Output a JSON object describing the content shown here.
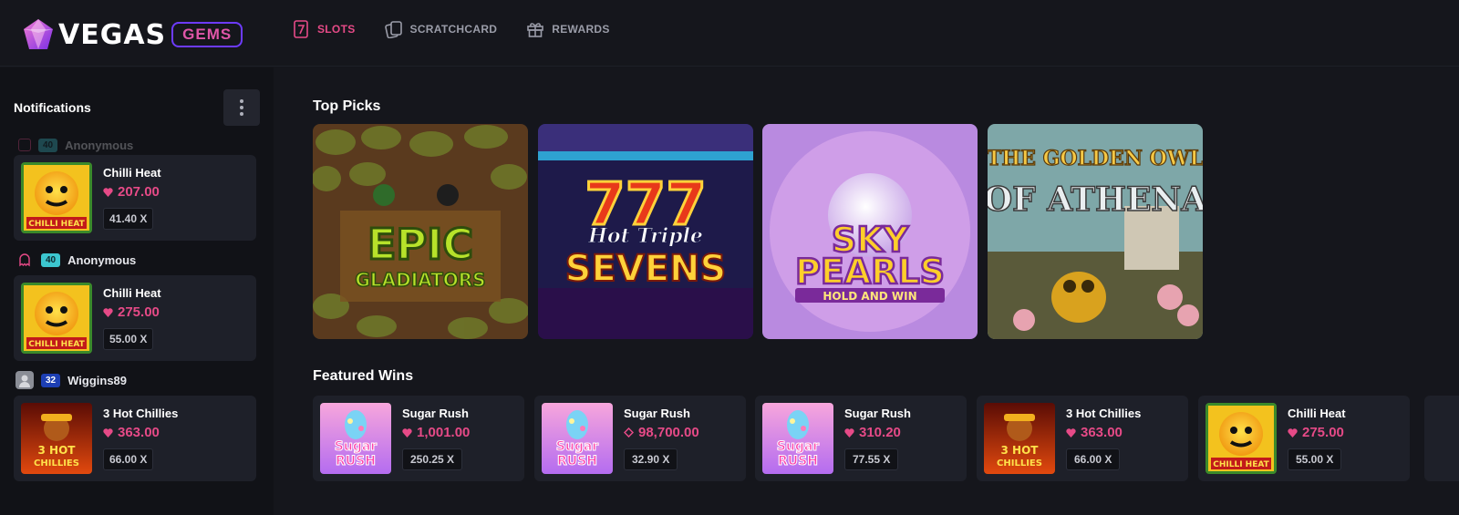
{
  "header": {
    "logo_word": "VEGAS",
    "logo_badge": "GEMS",
    "nav": [
      {
        "label": "SLOTS",
        "icon": "slot-seven-icon",
        "active": true
      },
      {
        "label": "SCRATCHCARD",
        "icon": "scratchcard-icon",
        "active": false
      },
      {
        "label": "REWARDS",
        "icon": "gift-icon",
        "active": false
      }
    ]
  },
  "sidebar": {
    "title": "Notifications",
    "ghost": {
      "level": "40",
      "user": "Anonymous"
    },
    "items": [
      {
        "user": null,
        "level": null,
        "game": "Chilli Heat",
        "amount": "207.00",
        "multiplier": "41.40 X"
      },
      {
        "user": "Anonymous",
        "level": "40",
        "game": "Chilli Heat",
        "amount": "275.00",
        "multiplier": "55.00 X"
      },
      {
        "user": "Wiggins89",
        "level": "32",
        "game": "3 Hot Chillies",
        "amount": "363.00",
        "multiplier": "66.00 X"
      }
    ]
  },
  "main": {
    "top_picks_title": "Top Picks",
    "featured_title": "Featured Wins",
    "top_picks": [
      {
        "line1": "EPIC",
        "line2": "GLADIATORS"
      },
      {
        "line1": "Hot Triple",
        "line2": "SEVENS"
      },
      {
        "line1": "SKY",
        "line2": "PEARLS",
        "line3": "HOLD AND WIN"
      },
      {
        "line1": "THE GOLDEN OWL",
        "line2": "OF ATHENA"
      }
    ],
    "featured": [
      {
        "game": "Sugar Rush",
        "amount": "1,001.00",
        "currency": "gem",
        "multiplier": "250.25 X"
      },
      {
        "game": "Sugar Rush",
        "amount": "98,700.00",
        "currency": "diamond",
        "multiplier": "32.90 X"
      },
      {
        "game": "Sugar Rush",
        "amount": "310.20",
        "currency": "gem",
        "multiplier": "77.55 X"
      },
      {
        "game": "3 Hot Chillies",
        "amount": "363.00",
        "currency": "gem",
        "multiplier": "66.00 X"
      },
      {
        "game": "Chilli Heat",
        "amount": "275.00",
        "currency": "gem",
        "multiplier": "55.00 X"
      }
    ]
  },
  "thumb_text": {
    "sugar_rush": [
      "Sugar",
      "RUSH"
    ],
    "chilli_heat": "CHILLI HEAT",
    "hot_chillies": [
      "3 HOT",
      "CHILLIES"
    ]
  },
  "colors": {
    "accent": "#e64a87",
    "badge_border": "#6d3bff",
    "bg": "#15161c",
    "card": "#1e2029"
  }
}
